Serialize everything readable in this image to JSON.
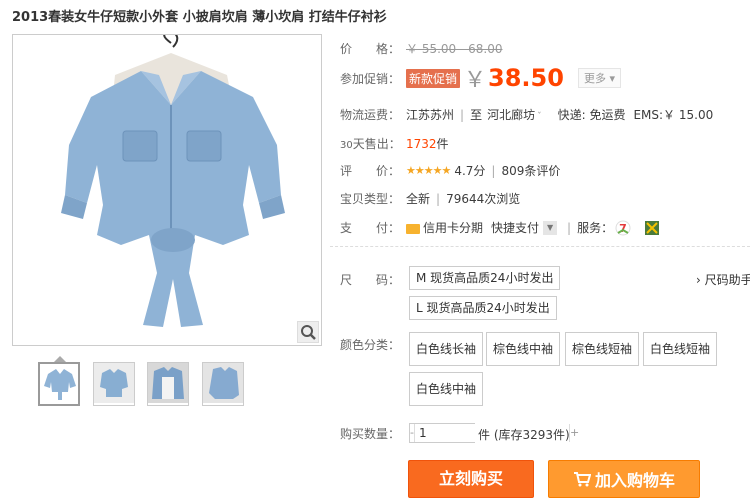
{
  "product": {
    "title": "2013春装女牛仔短款小外套 小披肩坎肩 薄小坎肩 打结牛仔衬衫"
  },
  "price": {
    "label": "价　　格：",
    "original": "￥ 55.00 - 68.00",
    "promo_label": "参加促销：",
    "promo_badge": "新款促销",
    "currency": "￥",
    "promo_price": "38.50",
    "more": "更多 ▾"
  },
  "shipping": {
    "label": "物流运费：",
    "from": "江苏苏州",
    "to_label": "至",
    "to": "河北廊坊",
    "fee_label": "快递: 免运费",
    "ems": "EMS:￥ 15.00"
  },
  "sales": {
    "label_prefix": "30",
    "label": "天售出：",
    "count": "1732",
    "unit": "件"
  },
  "rating": {
    "label": "评　　价：",
    "stars": "★★★★★",
    "score": "4.7分",
    "reviews": "809条评价"
  },
  "item_type": {
    "label": "宝贝类型：",
    "condition": "全新",
    "views": "79644次浏览"
  },
  "payment": {
    "label": "支　　付：",
    "method1": "信用卡分期",
    "method2": "快捷支付",
    "service_label": "服务："
  },
  "sizes": {
    "label": "尺　　码：",
    "options": [
      "M 现货高品质24小时发出",
      "L 现货高品质24小时发出"
    ],
    "guide": "› 尺码助手"
  },
  "colors": {
    "label": "颜色分类：",
    "options": [
      "白色线长袖",
      "棕色线中袖",
      "棕色线短袖",
      "白色线短袖",
      "白色线中袖"
    ]
  },
  "quantity": {
    "label": "购买数量：",
    "value": "1",
    "minus": "-",
    "plus": "+",
    "stock": "件 (库存3293件)"
  },
  "actions": {
    "buy": "立刻购买",
    "cart": "加入购物车"
  },
  "colors_theme": {
    "accent": "#ff4400",
    "buy_button": "#f96a1f",
    "cart_button": "#ff9a2f",
    "denim": "#8fb3d6"
  }
}
